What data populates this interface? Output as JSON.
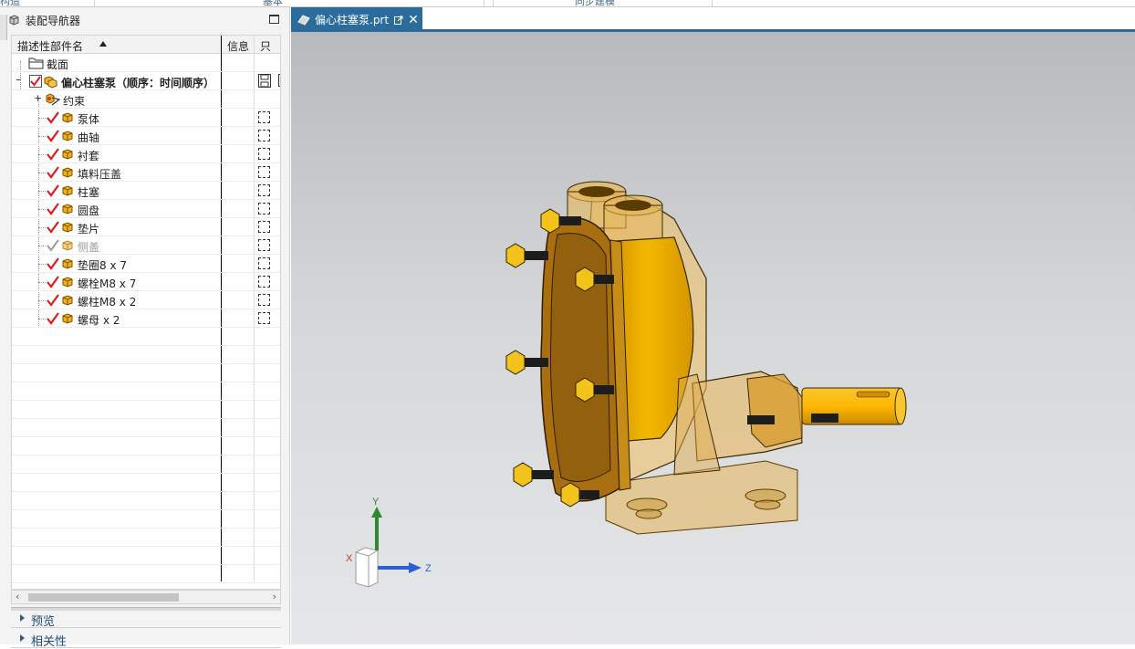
{
  "top_strip": {
    "labels": [
      "构造",
      "基本",
      "同步建模"
    ]
  },
  "navigator": {
    "title": "装配导航器",
    "columns": {
      "name": "描述性部件名",
      "info": "信息",
      "readonly": "只"
    },
    "rows": [
      {
        "label": "截面",
        "type": "folder",
        "checked": null,
        "bold": false
      },
      {
        "label": "偏心柱塞泵（顺序：时间顺序）",
        "type": "assembly",
        "checked": true,
        "bold": true
      },
      {
        "label": "约束",
        "type": "constraint",
        "checked": null,
        "bold": false
      },
      {
        "label": "泵体",
        "type": "part",
        "checked": true,
        "bold": false
      },
      {
        "label": "曲轴",
        "type": "part",
        "checked": true,
        "bold": false
      },
      {
        "label": "衬套",
        "type": "part",
        "checked": true,
        "bold": false
      },
      {
        "label": "填料压盖",
        "type": "part",
        "checked": true,
        "bold": false
      },
      {
        "label": "柱塞",
        "type": "part",
        "checked": true,
        "bold": false
      },
      {
        "label": "圆盘",
        "type": "part",
        "checked": true,
        "bold": false
      },
      {
        "label": "垫片",
        "type": "part",
        "checked": true,
        "bold": false
      },
      {
        "label": "侧盖",
        "type": "part",
        "checked": false,
        "bold": false
      },
      {
        "label": "垫圈8 x 7",
        "type": "part",
        "checked": true,
        "bold": false
      },
      {
        "label": "螺栓M8 x 7",
        "type": "part",
        "checked": true,
        "bold": false
      },
      {
        "label": "螺柱M8 x 2",
        "type": "part",
        "checked": true,
        "bold": false
      },
      {
        "label": "螺母 x 2",
        "type": "part",
        "checked": true,
        "bold": false
      }
    ],
    "sections": [
      "预览",
      "相关性"
    ]
  },
  "tab": {
    "title": "偏心柱塞泵.prt",
    "close": "✕"
  },
  "triad": {
    "x": "X",
    "y": "Y",
    "z": "Z"
  },
  "colors": {
    "accent": "#2a6d9c",
    "check": "#e01b1b",
    "part": "#f2b21d"
  }
}
